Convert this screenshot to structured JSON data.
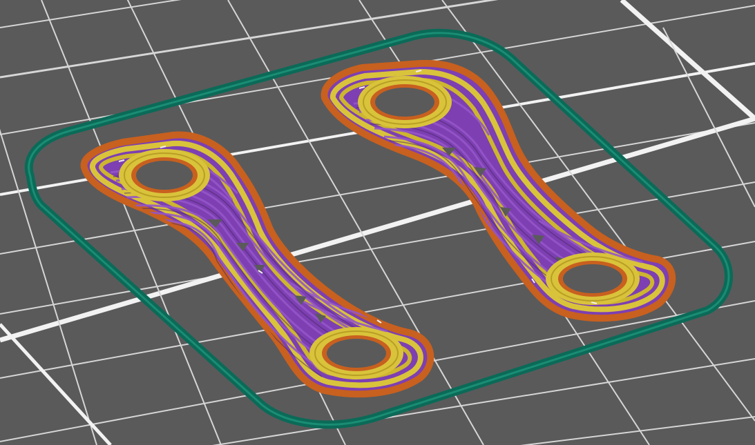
{
  "viewport": {
    "background": "#5a5a5a",
    "grid_color_minor": "#d6d6d6",
    "grid_color_major": "#f2f2f2"
  },
  "colors": {
    "skirt": "#0b6a58",
    "external_perimeter": "#c8601f",
    "perimeter": "#d9c33b",
    "infill": "#7d3fb2",
    "gap_fill": "#f0f0f0"
  },
  "objects": [
    {
      "id": "part-1"
    },
    {
      "id": "part-2"
    }
  ]
}
